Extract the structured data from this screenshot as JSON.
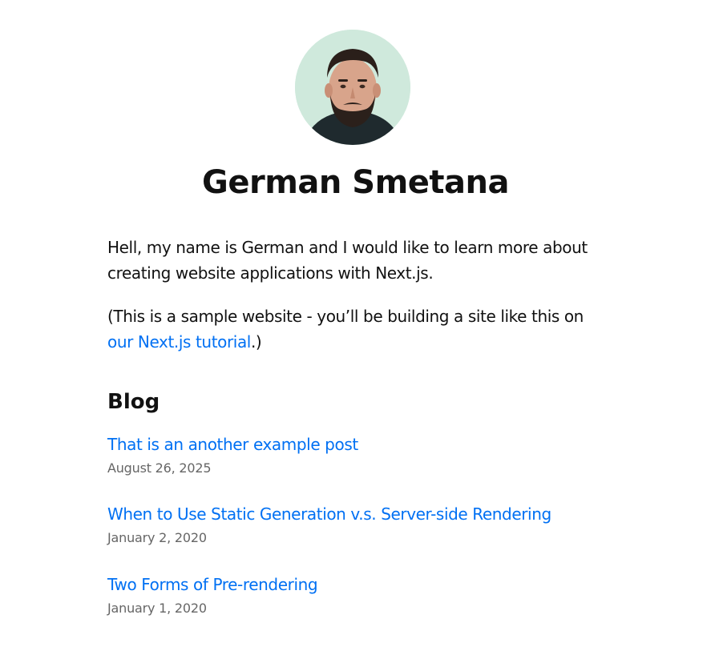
{
  "profile": {
    "name": "German Smetana",
    "avatar_icon": "profile-photo"
  },
  "intro": {
    "text": "Hell, my name is German and I would like to learn more about creating website applications with Next.js.",
    "note_prefix": "(This is a sample website - you’ll be building a site like this on ",
    "note_link": "our Next.js tutorial",
    "note_suffix": ".)"
  },
  "blog": {
    "heading": "Blog",
    "posts": [
      {
        "title": "That is an another example post",
        "date": "August 26, 2025"
      },
      {
        "title": "When to Use Static Generation v.s. Server-side Rendering",
        "date": "January 2, 2020"
      },
      {
        "title": "Two Forms of Pre-rendering",
        "date": "January 1, 2020"
      }
    ]
  },
  "colors": {
    "link": "#0070f3",
    "date": "#666666",
    "text": "#111111",
    "avatar_bg": "#cfe9dc"
  }
}
